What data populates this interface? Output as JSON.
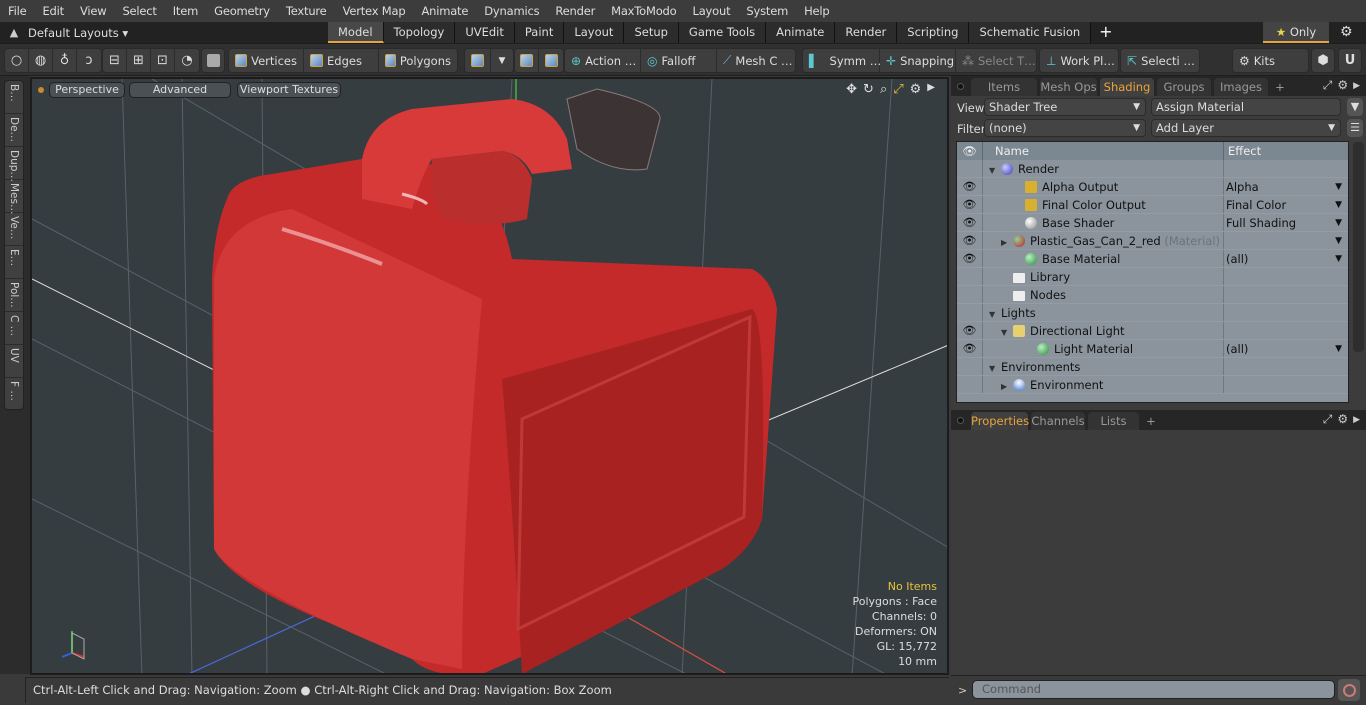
{
  "menubar": {
    "items": [
      "File",
      "Edit",
      "View",
      "Select",
      "Item",
      "Geometry",
      "Texture",
      "Vertex Map",
      "Animate",
      "Dynamics",
      "Render",
      "MaxToModo",
      "Layout",
      "System",
      "Help"
    ]
  },
  "layoutbar": {
    "layouts_label": "Default Layouts ▾",
    "tabs": [
      {
        "label": "Model",
        "active": true
      },
      {
        "label": "Topology"
      },
      {
        "label": "UVEdit"
      },
      {
        "label": "Paint"
      },
      {
        "label": "Layout"
      },
      {
        "label": "Setup"
      },
      {
        "label": "Game Tools"
      },
      {
        "label": "Animate"
      },
      {
        "label": "Render"
      },
      {
        "label": "Scripting"
      },
      {
        "label": "Schematic Fusion"
      }
    ],
    "add_tab": "+",
    "only_label": "Only"
  },
  "toolbar": {
    "vertices": "Vertices",
    "edges": "Edges",
    "polygons": "Polygons",
    "action": "Action …",
    "falloff": "Falloff",
    "mesh_c": "Mesh C …",
    "symm": "Symm …",
    "snapping": "Snapping",
    "select_t": "Select T…",
    "work_pl": "Work Pl…",
    "selecti": "Selecti …",
    "kits": "Kits"
  },
  "left_strip": {
    "tabs": [
      "B…",
      "De…",
      "Dup…",
      "Mes…",
      "Ve…",
      "E…",
      "Pol…",
      "C …",
      "UV",
      "F …"
    ]
  },
  "viewport": {
    "perspective": "Perspective",
    "advanced": "Advanced",
    "viewport_textures": "Viewport Textures",
    "info": {
      "no_items": "No Items",
      "polygons": "Polygons : Face",
      "channels": "Channels: 0",
      "deformers": "Deformers: ON",
      "gl": "GL: 15,772",
      "scale": "10 mm"
    },
    "object_color": "#d23a3a"
  },
  "statusbar": {
    "hint": "Ctrl-Alt-Left Click and Drag: Navigation: Zoom ● Ctrl-Alt-Right Click and Drag: Navigation: Box Zoom"
  },
  "right_panel": {
    "tabs": [
      {
        "label": "Items"
      },
      {
        "label": "Mesh Ops"
      },
      {
        "label": "Shading",
        "active": true
      },
      {
        "label": "Groups"
      },
      {
        "label": "Images"
      }
    ],
    "add_tab": "+",
    "view_label": "View",
    "view_value": "Shader Tree",
    "assign_material": "Assign Material",
    "filter_label": "Filter",
    "filter_value": "(none)",
    "add_layer": "Add Layer",
    "columns": {
      "name": "Name",
      "effect": "Effect"
    },
    "rows": [
      {
        "name": "Render",
        "effect": "",
        "eye": false,
        "indent": 0,
        "expander": "▼",
        "icon": "render-sphere",
        "has_dd": false
      },
      {
        "name": "Alpha Output",
        "effect": "Alpha",
        "eye": true,
        "indent": 2,
        "expander": "",
        "icon": "output",
        "has_dd": true
      },
      {
        "name": "Final Color Output",
        "effect": "Final Color",
        "eye": true,
        "indent": 2,
        "expander": "",
        "icon": "output",
        "has_dd": true
      },
      {
        "name": "Base Shader",
        "effect": "Full Shading",
        "eye": true,
        "indent": 2,
        "expander": "",
        "icon": "shader",
        "has_dd": true
      },
      {
        "name": "Plastic_Gas_Can_2_red",
        "tag": "(Material)",
        "effect": "",
        "eye": true,
        "indent": 1,
        "expander": "▶",
        "icon": "material-red",
        "has_dd": true
      },
      {
        "name": "Base Material",
        "effect": "(all)",
        "eye": true,
        "indent": 2,
        "expander": "",
        "icon": "material",
        "has_dd": true
      },
      {
        "name": "Library",
        "effect": "",
        "eye": false,
        "indent": 1,
        "expander": "",
        "icon": "folder",
        "has_dd": false
      },
      {
        "name": "Nodes",
        "effect": "",
        "eye": false,
        "indent": 1,
        "expander": "",
        "icon": "folder",
        "has_dd": false
      },
      {
        "name": "Lights",
        "effect": "",
        "eye": false,
        "indent": 0,
        "expander": "▼",
        "icon": "",
        "has_dd": false
      },
      {
        "name": "Directional Light",
        "effect": "",
        "eye": true,
        "indent": 1,
        "expander": "▼",
        "icon": "light",
        "has_dd": false
      },
      {
        "name": "Light Material",
        "effect": "(all)",
        "eye": true,
        "indent": 3,
        "expander": "",
        "icon": "material",
        "has_dd": true
      },
      {
        "name": "Environments",
        "effect": "",
        "eye": false,
        "indent": 0,
        "expander": "▼",
        "icon": "",
        "has_dd": false
      },
      {
        "name": "Environment",
        "effect": "",
        "eye": false,
        "indent": 1,
        "expander": "▶",
        "icon": "environment",
        "has_dd": false
      }
    ],
    "bottom_tabs": [
      {
        "label": "Properties",
        "active": true
      },
      {
        "label": "Channels"
      },
      {
        "label": "Lists"
      }
    ],
    "command_placeholder": "Command",
    "command_prompt": ">"
  }
}
